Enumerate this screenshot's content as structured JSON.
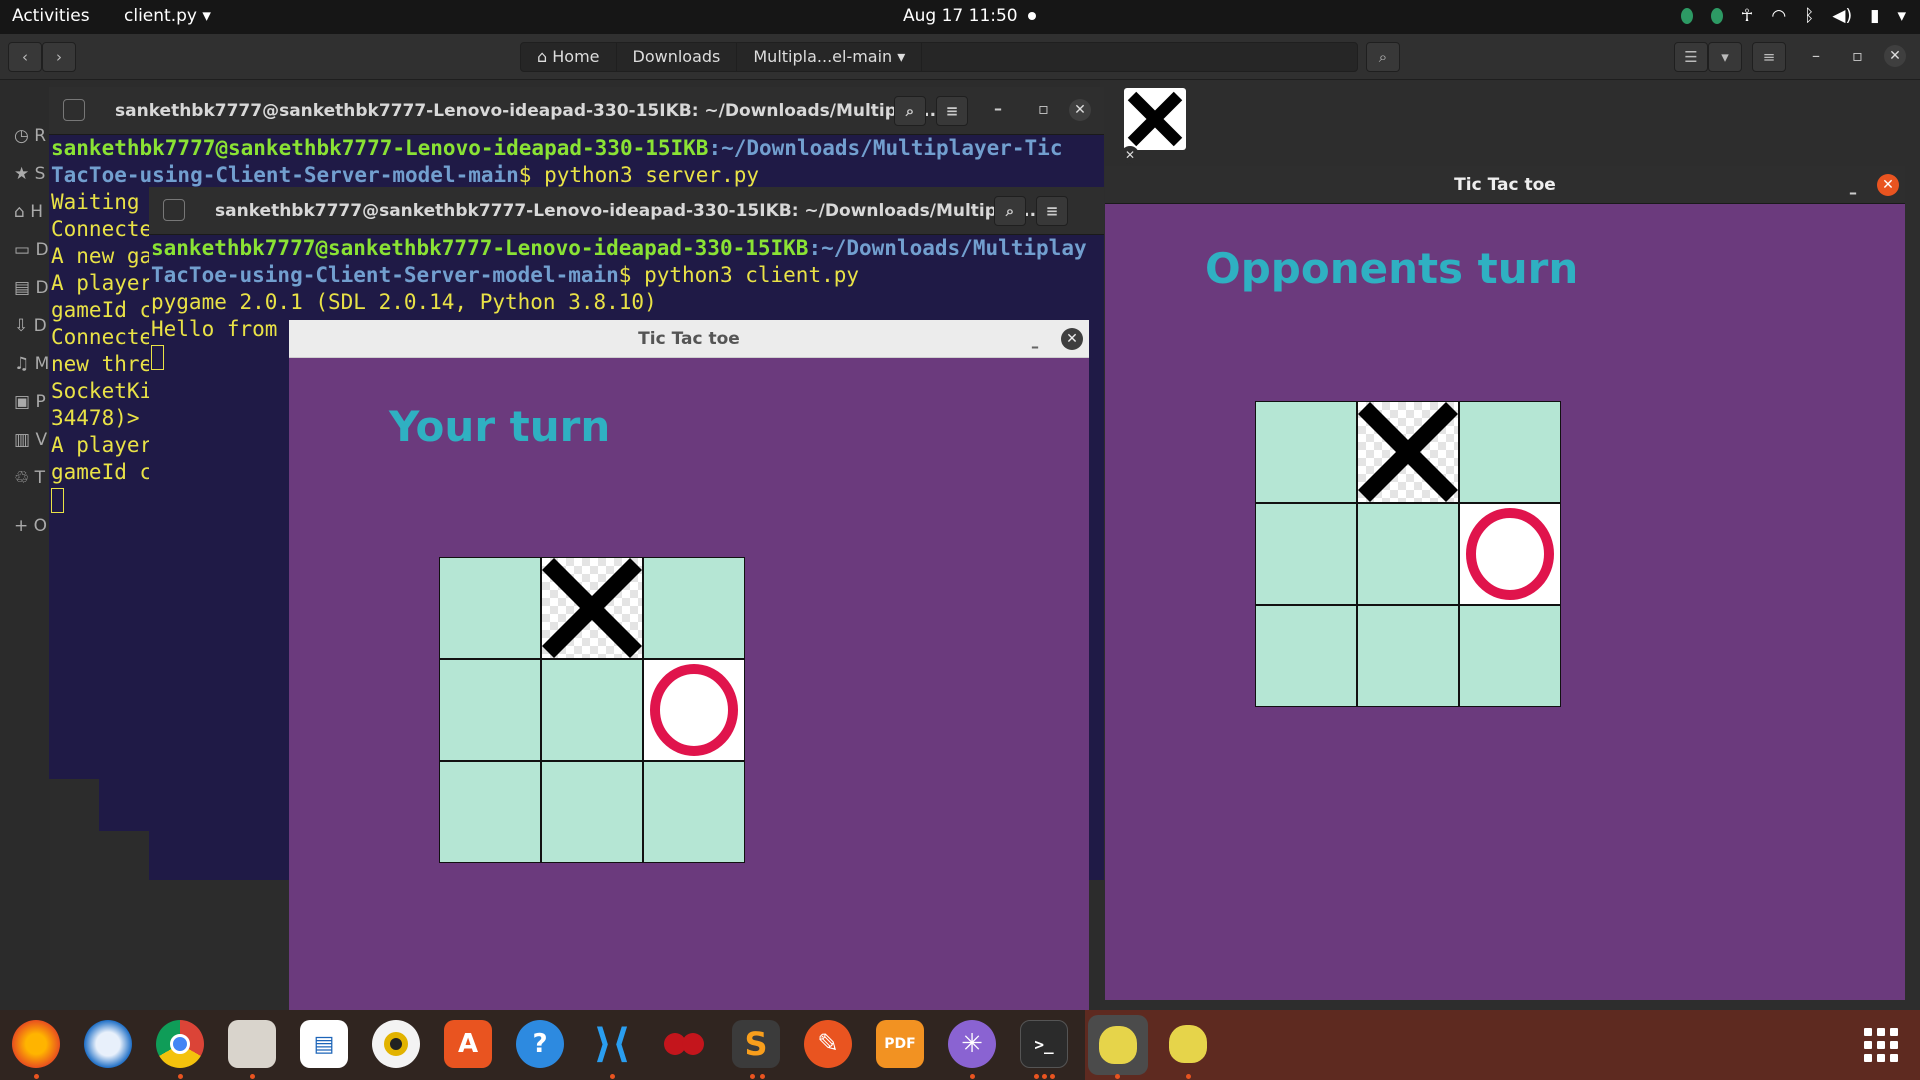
{
  "topbar": {
    "activities": "Activities",
    "app_name": "client.py",
    "clock": "Aug 17  11:50"
  },
  "files": {
    "path": [
      "Home",
      "Downloads",
      "Multipla...el-main"
    ],
    "sidebar_initials": [
      "R",
      "S",
      "H",
      "D",
      "D",
      "D",
      "M",
      "P",
      "V",
      "T",
      "+ O"
    ]
  },
  "server_terminal": {
    "title": "sankethbk7777@sankethbk7777-Lenovo-ideapad-330-15IKB: ~/Downloads/Multiplay...",
    "prompt_user": "sankethbk7777@sankethbk7777-Lenovo-ideapad-330-15IKB",
    "prompt_path_1": ":~/Downloads/Multiplayer-Tic",
    "prompt_path_2": "TacToe-using-Client-Server-model-main",
    "command": "$ python3 server.py",
    "lines": [
      "Waiting",
      "Connecte",
      "A new ga",
      "A player",
      "gameId c",
      "Connecte",
      "new thre",
      "SocketKi",
      "34478)>",
      "A player",
      "gameId c"
    ]
  },
  "client_terminal": {
    "title": "sankethbk7777@sankethbk7777-Lenovo-ideapad-330-15IKB: ~/Downloads/Multiplay...",
    "prompt_user": "sankethbk7777@sankethbk7777-Lenovo-ideapad-330-15IKB",
    "prompt_path_1": ":~/Downloads/Multiplay",
    "prompt_path_2": "TacToe-using-Client-Server-model-main",
    "command": "$ python3 client.py",
    "lines": [
      "pygame 2.0.1 (SDL 2.0.14, Python 3.8.10)",
      "Hello from"
    ]
  },
  "game_left": {
    "title": "Tic Tac toe",
    "turn_text": "Your turn",
    "board": [
      "",
      "X",
      "",
      "",
      "",
      "O",
      "",
      "",
      ""
    ]
  },
  "game_right": {
    "title": "Tic Tac toe",
    "turn_text": "Opponents turn",
    "board": [
      "",
      "X",
      "",
      "",
      "",
      "O",
      "",
      "",
      ""
    ]
  },
  "colors": {
    "game_bg": "#6b3a7d",
    "turn_text": "#2fb0c2",
    "cell": "#b5e6d4",
    "o_mark": "#e0144c",
    "x_mark": "#000000"
  },
  "dock": {
    "apps": [
      "firefox-icon",
      "thunderbird-icon",
      "chrome-icon",
      "files-icon",
      "writer-icon",
      "rhythmbox-icon",
      "software-icon",
      "help-icon",
      "vscode-icon",
      "cherrytree-icon",
      "sublime-icon",
      "inkscape-icon",
      "pdf-icon",
      "network-icon",
      "terminal-icon",
      "pygame-icon",
      "pygame-icon"
    ]
  }
}
